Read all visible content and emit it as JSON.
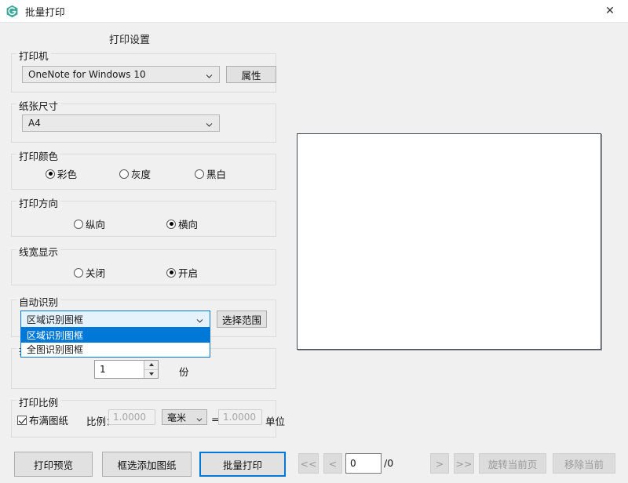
{
  "window": {
    "title": "批量打印",
    "icon": "app-hexagon-icon",
    "close_label": "✕",
    "accent": "#0078d7",
    "icon_color": "#3aa79a"
  },
  "settings": {
    "heading": "打印设置",
    "printer": {
      "legend": "打印机",
      "value": "OneNote for Windows 10",
      "properties_button": "属性"
    },
    "paper": {
      "legend": "纸张尺寸",
      "value": "A4"
    },
    "color": {
      "legend": "打印颜色",
      "options": [
        {
          "label": "彩色",
          "selected": true
        },
        {
          "label": "灰度",
          "selected": false
        },
        {
          "label": "黑白",
          "selected": false
        }
      ]
    },
    "orientation": {
      "legend": "打印方向",
      "options": [
        {
          "label": "纵向",
          "selected": false
        },
        {
          "label": "横向",
          "selected": true
        }
      ]
    },
    "linewidth": {
      "legend": "线宽显示",
      "options": [
        {
          "label": "关闭",
          "selected": false
        },
        {
          "label": "开启",
          "selected": true
        }
      ]
    },
    "autodetect": {
      "legend": "自动识别",
      "value": "区域识别图框",
      "range_button": "选择范围",
      "open": true,
      "options": [
        {
          "label": "区域识别图框",
          "highlighted": true
        },
        {
          "label": "全图识别图框",
          "highlighted": false
        }
      ]
    },
    "copies": {
      "legend": "打印份数",
      "value": "1",
      "unit": "份"
    },
    "scale": {
      "legend": "打印比例",
      "fit_label": "布满图纸",
      "fit_checked": true,
      "ratio_label": "比例：",
      "ratio_value": "1.0000",
      "unit_value": "毫米",
      "equals": "=",
      "equals_value": "1.0000",
      "unit_label": "单位"
    }
  },
  "actions": {
    "preview": "打印预览",
    "add_drawing": "框选添加图纸",
    "batch_print": "批量打印"
  },
  "nav": {
    "first": "<<",
    "prev": "<",
    "page_value": "0",
    "page_total": "/0",
    "next": ">",
    "last": ">>",
    "rotate": "旋转当前页",
    "remove": "移除当前"
  }
}
